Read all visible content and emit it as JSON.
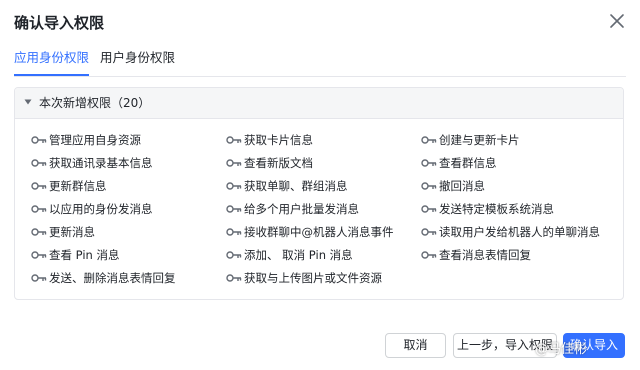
{
  "dialog": {
    "title": "确认导入权限",
    "close_icon": "close-icon"
  },
  "tabs": [
    {
      "label": "应用身份权限",
      "active": true
    },
    {
      "label": "用户身份权限",
      "active": false
    }
  ],
  "section": {
    "title": "本次新增权限（20）",
    "expanded": true
  },
  "permissions": [
    [
      "管理应用自身资源",
      "获取卡片信息",
      "创建与更新卡片"
    ],
    [
      "获取通讯录基本信息",
      "查看新版文档",
      "查看群信息"
    ],
    [
      "更新群信息",
      "获取单聊、群组消息",
      "撤回消息"
    ],
    [
      "以应用的身份发消息",
      "给多个用户批量发消息",
      "发送特定模板系统消息"
    ],
    [
      "更新消息",
      "接收群聊中@机器人消息事件",
      "读取用户发给机器人的单聊消息"
    ],
    [
      "查看 Pin 消息",
      "添加、 取消 Pin 消息",
      "查看消息表情回复"
    ],
    [
      "发送、删除消息表情回复",
      "获取与上传图片或文件资源",
      ""
    ]
  ],
  "footer": {
    "cancel_label": "取消",
    "prev_label": "上一步，导入权限",
    "confirm_label": "确认导入"
  },
  "watermark": "@马佳彬",
  "colors": {
    "accent": "#3370ff",
    "border": "#e5e6eb",
    "panel_header_bg": "#f5f6f7",
    "text": "#1f2329",
    "icon": "#646a73"
  }
}
